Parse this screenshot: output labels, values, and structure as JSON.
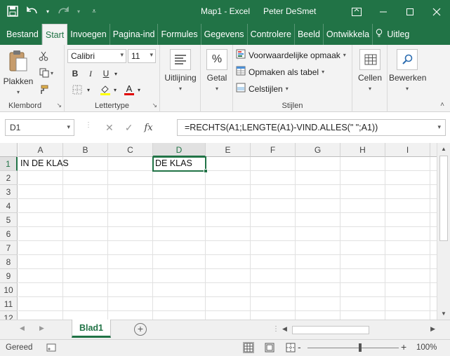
{
  "titlebar": {
    "document_title": "Map1 - Excel",
    "user_name": "Peter DeSmet"
  },
  "tabs": [
    {
      "label": "Bestand"
    },
    {
      "label": "Start"
    },
    {
      "label": "Invoegen"
    },
    {
      "label": "Pagina-ind"
    },
    {
      "label": "Formules"
    },
    {
      "label": "Gegevens"
    },
    {
      "label": "Controlere"
    },
    {
      "label": "Beeld"
    },
    {
      "label": "Ontwikkela"
    },
    {
      "label": "Uitleg"
    }
  ],
  "ribbon": {
    "clipboard": {
      "paste_label": "Plakken",
      "group_label": "Klembord"
    },
    "font": {
      "font_name": "Calibri",
      "font_size": "11",
      "group_label": "Lettertype",
      "bold": "B",
      "italic": "I",
      "underline": "U"
    },
    "alignment": {
      "label": "Uitlijning"
    },
    "number": {
      "label": "Getal"
    },
    "styles": {
      "conditional": "Voorwaardelijke opmaak",
      "format_table": "Opmaken als tabel",
      "cell_styles": "Celstijlen",
      "group_label": "Stijlen"
    },
    "cells": {
      "label": "Cellen"
    },
    "editing": {
      "label": "Bewerken"
    }
  },
  "formula_bar": {
    "name_box": "D1",
    "fx": "fx",
    "formula": "=RECHTS(A1;LENGTE(A1)-VIND.ALLES(\" \";A1))"
  },
  "grid": {
    "columns": [
      "A",
      "B",
      "C",
      "D",
      "E",
      "F",
      "G",
      "H",
      "I"
    ],
    "rows": [
      "1",
      "2",
      "3",
      "4",
      "5",
      "6",
      "7",
      "8",
      "9",
      "10",
      "11",
      "12"
    ],
    "cells": {
      "A1": "IN DE KLAS",
      "D1": "DE KLAS"
    },
    "active_cell": "D1"
  },
  "sheets": [
    {
      "label": "Blad1"
    }
  ],
  "statusbar": {
    "ready": "Gereed",
    "zoom_minus": "-",
    "zoom_plus": "+",
    "zoom": "100%"
  },
  "colors": {
    "accent": "#217346"
  }
}
